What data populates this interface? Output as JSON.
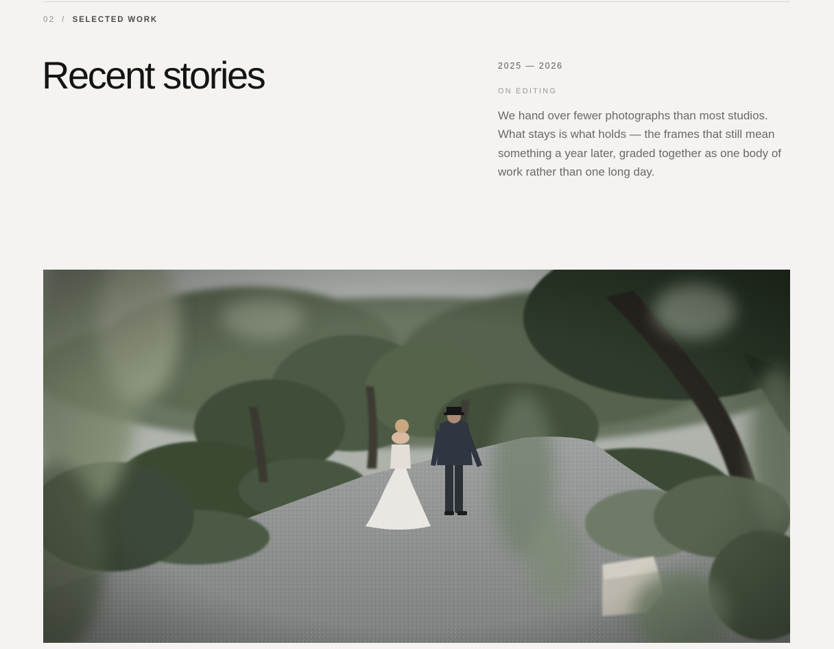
{
  "section": {
    "number": "02",
    "separator": "/",
    "label": "SELECTED WORK"
  },
  "heading": {
    "title": "Recent stories"
  },
  "meta": {
    "years": "2025 — 2026",
    "label": "ON EDITING",
    "body": "We hand over fewer photographs than most studios. What stays is what holds — the frames that still mean something a year later, graded together as one body of work rather than one long day."
  },
  "feature_image": {
    "subject": "couple-walking-olive-grove-path-photo"
  },
  "colors": {
    "background": "#f4f3f1",
    "heading": "#141414",
    "body_text": "#6b6966",
    "muted": "#9a9895"
  }
}
